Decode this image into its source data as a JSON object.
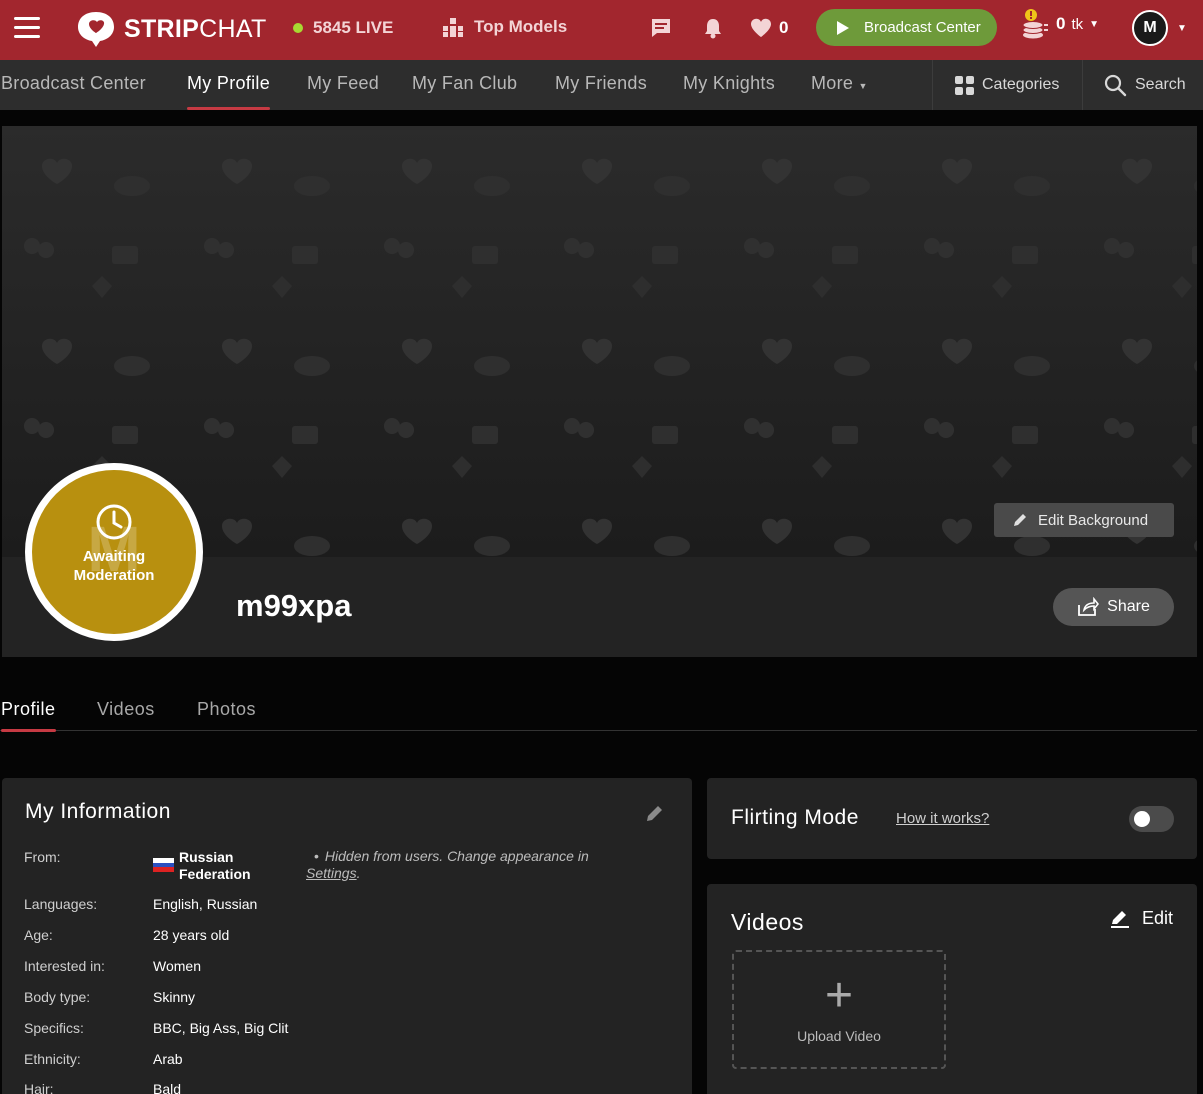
{
  "brand": {
    "name_bold": "STRIP",
    "name_thin": "CHAT"
  },
  "topbar": {
    "live_count": "5845 LIVE",
    "top_models": "Top Models",
    "favorites_count": "0",
    "broadcast_button": "Broadcast Center",
    "tokens_amount": "0",
    "tokens_unit": "tk",
    "avatar_letter": "M"
  },
  "nav": {
    "items": [
      {
        "label": "Broadcast Center"
      },
      {
        "label": "My Profile"
      },
      {
        "label": "My Feed"
      },
      {
        "label": "My Fan Club"
      },
      {
        "label": "My Friends"
      },
      {
        "label": "My Knights"
      },
      {
        "label": "More"
      }
    ],
    "categories": "Categories",
    "search": "Search"
  },
  "cover": {
    "edit_background": "Edit Background",
    "avatar_letter": "M",
    "avatar_status_line1": "Awaiting",
    "avatar_status_line2": "Moderation",
    "username": "m99xpa",
    "share": "Share"
  },
  "subtabs": [
    {
      "label": "Profile"
    },
    {
      "label": "Videos"
    },
    {
      "label": "Photos"
    }
  ],
  "my_information": {
    "title": "My Information",
    "from_label": "From:",
    "from_value_line1": "Russian",
    "from_value_line2": "Federation",
    "hidden_note": "Hidden from users. Change appearance in",
    "hidden_note_link": "Settings",
    "rows": [
      {
        "label": "Languages:",
        "value": "English, Russian"
      },
      {
        "label": "Age:",
        "value": "28 years old"
      },
      {
        "label": "Interested in:",
        "value": "Women"
      },
      {
        "label": "Body type:",
        "value": "Skinny"
      },
      {
        "label": "Specifics:",
        "value": "BBC, Big Ass, Big Clit"
      },
      {
        "label": "Ethnicity:",
        "value": "Arab"
      },
      {
        "label": "Hair:",
        "value": "Bald"
      }
    ]
  },
  "flirting": {
    "title": "Flirting Mode",
    "how_it_works": "How it works?",
    "enabled": false
  },
  "videos_panel": {
    "title": "Videos",
    "edit": "Edit",
    "upload": "Upload Video"
  },
  "colors": {
    "topbar": "#a2262e",
    "accent": "#c63a43",
    "broadcast_green": "#6e9a3a",
    "live_dot": "#a8d932",
    "avatar_gold": "#b8900f"
  }
}
